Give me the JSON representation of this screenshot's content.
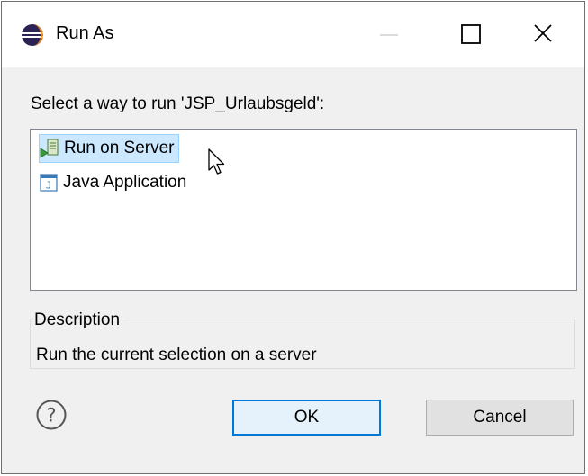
{
  "window": {
    "title": "Run As",
    "icons": {
      "app": "eclipse-icon",
      "minimize": "minimize-icon",
      "maximize": "maximize-icon",
      "close": "close-icon"
    }
  },
  "dialog": {
    "prompt": "Select a way to run 'JSP_Urlaubsgeld':",
    "run_options": [
      {
        "label": "Run on Server",
        "icon": "server-run-icon",
        "selected": true
      },
      {
        "label": "Java Application",
        "icon": "java-app-icon",
        "selected": false
      }
    ],
    "description": {
      "legend": "Description",
      "text": "Run the current selection on a server"
    },
    "buttons": {
      "help_icon": "help-icon",
      "ok": "OK",
      "cancel": "Cancel"
    }
  },
  "colors": {
    "selection_bg": "#cce8ff",
    "default_button_border": "#0078d7",
    "dialog_bg": "#f0f0f0"
  }
}
